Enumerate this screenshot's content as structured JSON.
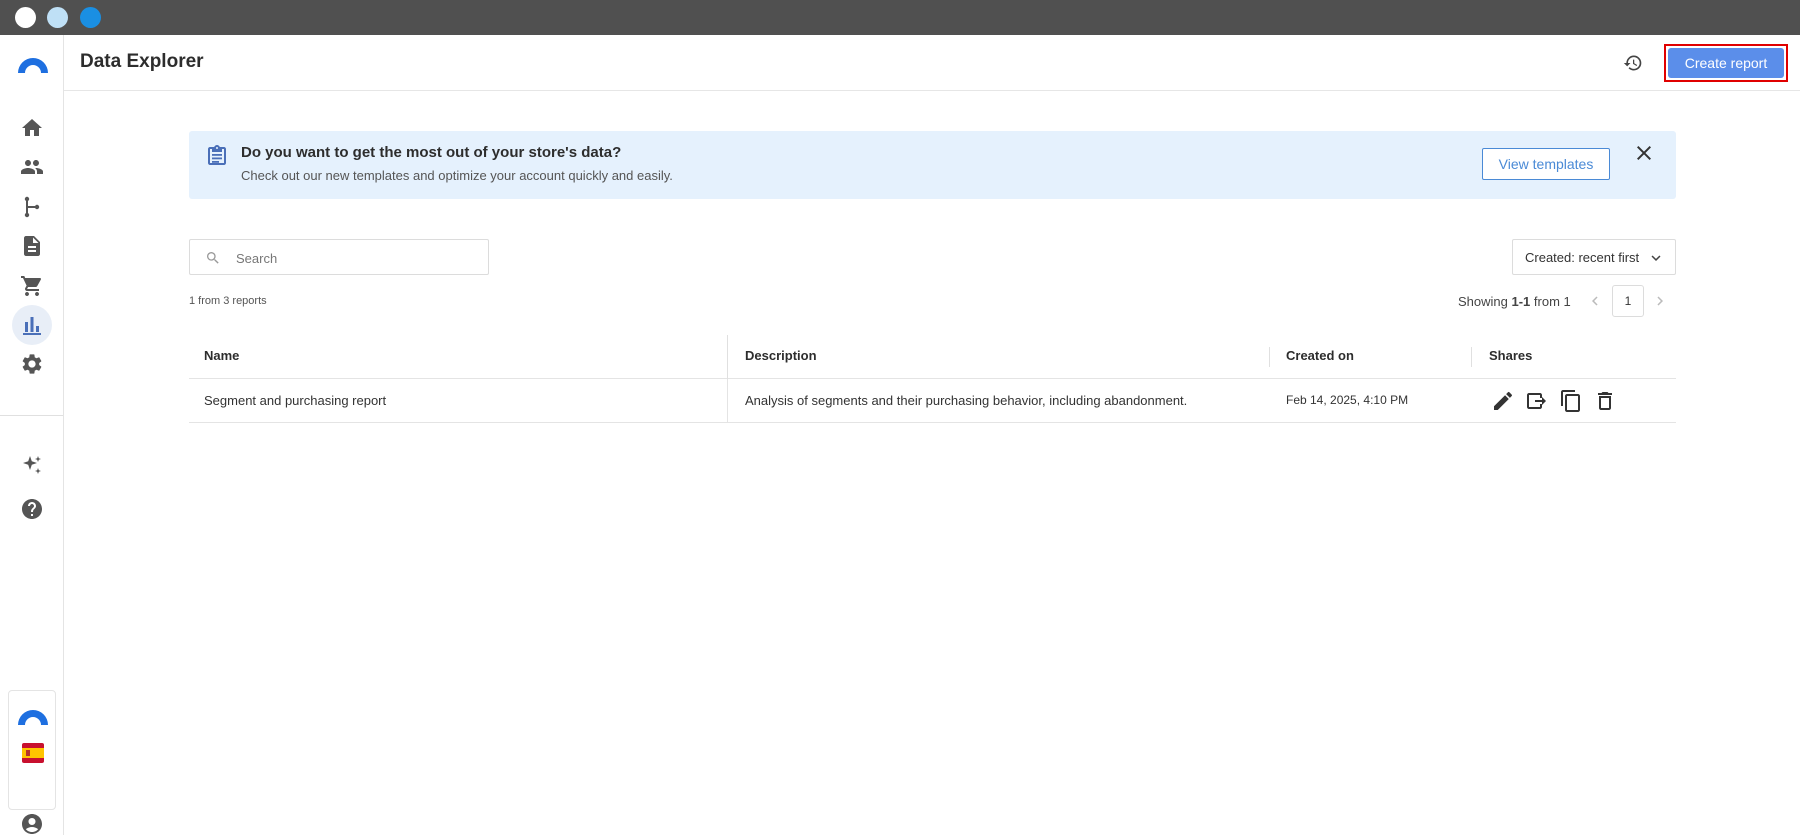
{
  "window": {
    "controls": [
      "close",
      "minimize",
      "maximize"
    ]
  },
  "sidebar": {
    "items": [
      {
        "icon": "home-icon"
      },
      {
        "icon": "users-icon"
      },
      {
        "icon": "flow-icon"
      },
      {
        "icon": "document-icon"
      },
      {
        "icon": "cart-icon"
      },
      {
        "icon": "bar-chart-icon",
        "active": true
      },
      {
        "icon": "settings-icon"
      },
      {
        "icon": "sparkle-icon"
      },
      {
        "icon": "help-icon"
      }
    ],
    "bottom": [
      "brand-logo-icon",
      "spain-flag-icon",
      "account-icon"
    ]
  },
  "header": {
    "title": "Data Explorer",
    "create_label": "Create report"
  },
  "banner": {
    "title": "Do you want to get the most out of your store's data?",
    "subtitle": "Check out our new templates and optimize your account quickly and easily.",
    "button_label": "View templates"
  },
  "search": {
    "placeholder": "Search",
    "value": ""
  },
  "sort": {
    "label": "Created: recent first"
  },
  "count_text": "1 from 3 reports",
  "pagination": {
    "prefix": "Showing ",
    "range": "1-1",
    "suffix": " from 1",
    "current_page": "1"
  },
  "table": {
    "columns": [
      "Name",
      "Description",
      "Created on",
      "Shares"
    ],
    "rows": [
      {
        "name": "Segment and purchasing report",
        "description": "Analysis of segments and their purchasing behavior, including abandonment.",
        "created_on": "Feb 14, 2025, 4:10 PM",
        "actions": [
          "edit-icon",
          "export-icon",
          "copy-icon",
          "delete-icon"
        ]
      }
    ]
  },
  "colors": {
    "accent": "#5b8eea",
    "banner_bg": "#e5f1fd",
    "highlight": "#e00000"
  }
}
